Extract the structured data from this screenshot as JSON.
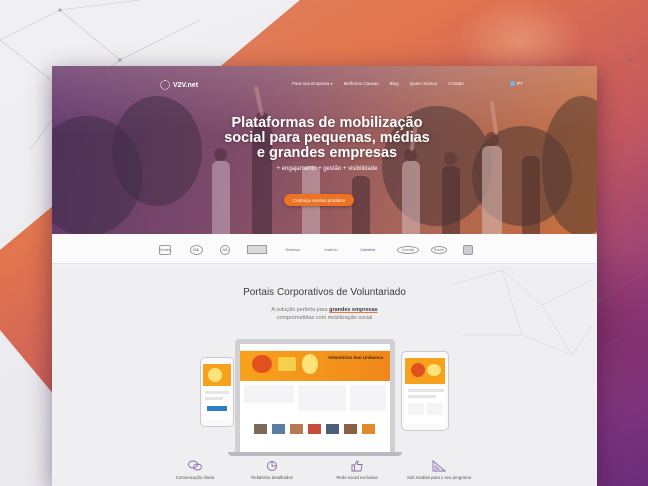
{
  "brand": {
    "logo": "V2V.net"
  },
  "nav": {
    "items": [
      "Para sua Empresa",
      "Melhores Causas",
      "Blog",
      "Quem Somos",
      "Contato"
    ],
    "lang": "PT"
  },
  "hero": {
    "title_lines": [
      "Plataformas de mobilização",
      "social para pequenas, médias",
      "e grandes empresas"
    ],
    "subtitle": "+ engajamento + gestão + visibilidade",
    "cta": "Conheça nossos produtos"
  },
  "clients": [
    "Nestlé",
    "OA",
    "AB",
    "",
    "Bradesco",
    "Instituto",
    "Carrefour",
    "Cerealia",
    "Roche",
    ""
  ],
  "portais": {
    "title": "Portais Corporativos de Voluntariado",
    "subtitle_pre": "A solução perfeita para",
    "subtitle_highlight": "grandes empresas",
    "subtitle_line2": "comprometidas com mobilização social",
    "laptop_banner": "Voluntários Itaú Unibanco"
  },
  "features": [
    {
      "icon": "chat-bubbles-icon",
      "label": "Comunicação direta"
    },
    {
      "icon": "report-icon",
      "label": "Relatórios detalhados"
    },
    {
      "icon": "thumbs-up-icon",
      "label": "Rede social exclusiva"
    },
    {
      "icon": "ruler-triangle-icon",
      "label": "Sob medida para o seu programa"
    }
  ],
  "colors": {
    "accent": "#ee7223",
    "purple": "#6a2c79",
    "text": "#3b3b44"
  }
}
